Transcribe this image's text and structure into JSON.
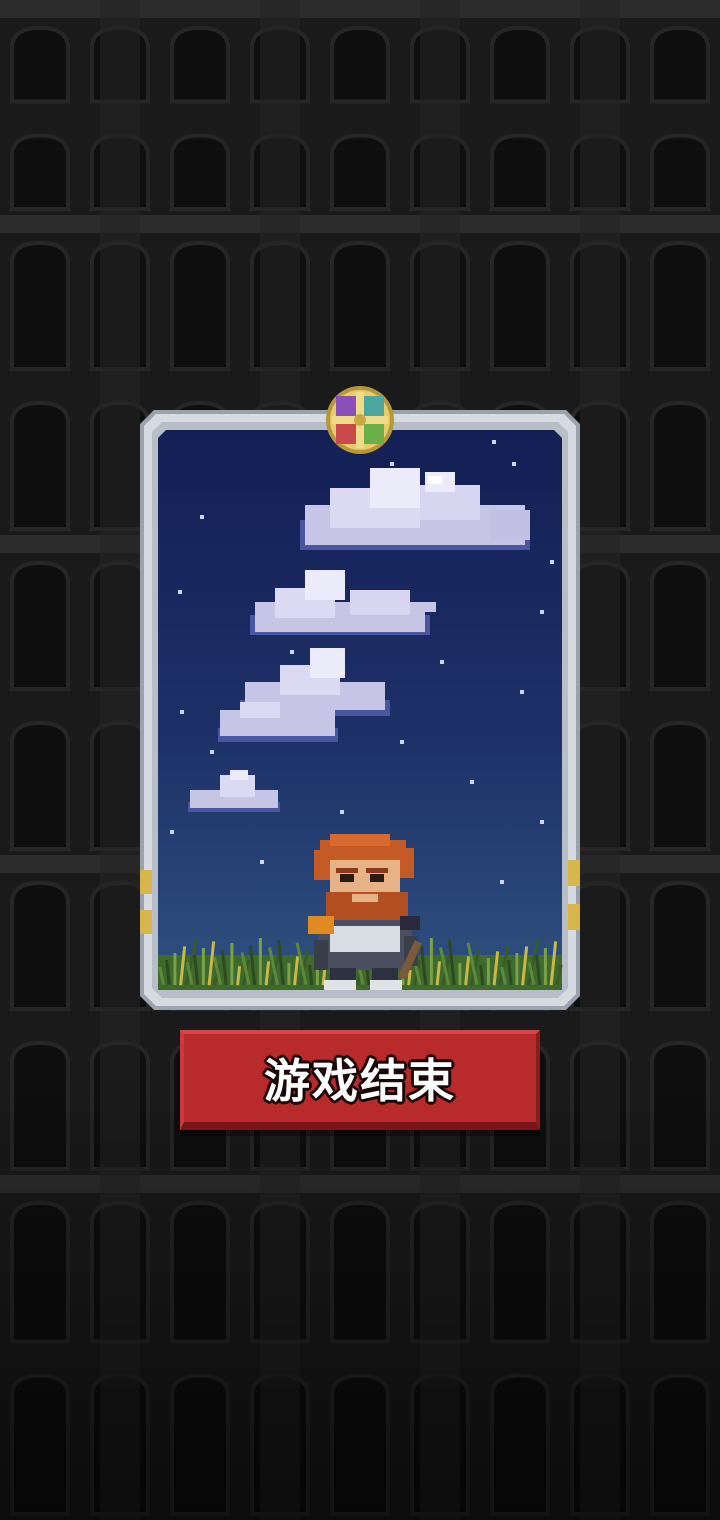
{
  "screen": {
    "name": "game-over"
  },
  "card": {
    "emblem_icon": "four-quadrant-emblem-icon",
    "character": "red-bearded-knight",
    "scene": "night-sky-with-clouds-and-grass"
  },
  "end_button": {
    "label": "游戏结束"
  },
  "colors": {
    "background": "#1b1b1b",
    "tower_stone": "#2a2a2a",
    "card_frame": "#c9ced6",
    "sky_top": "#16235a",
    "sky_bottom": "#2b4a7c",
    "button_red": "#b82a2c",
    "grass": "#3e6a2c"
  }
}
